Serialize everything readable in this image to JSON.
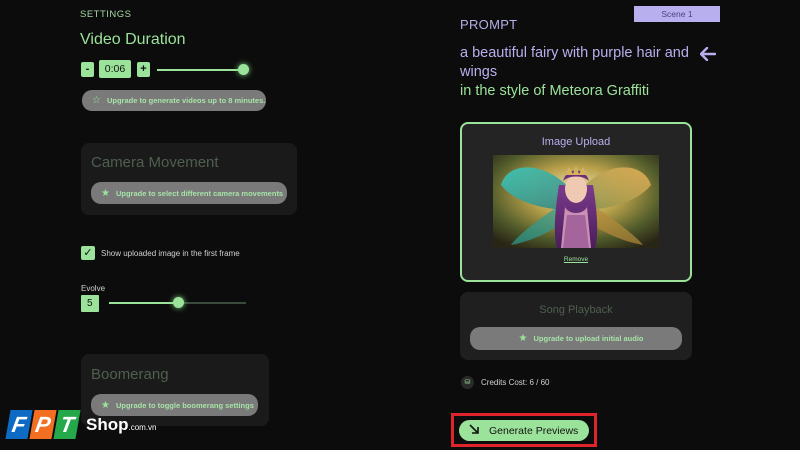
{
  "settings": {
    "label": "SETTINGS",
    "video_duration": {
      "title": "Video Duration",
      "minus": "-",
      "plus": "+",
      "value": "0:06",
      "slider_fraction": 1.0,
      "upgrade_text": "Upgrade to generate videos up to 8 minutes."
    },
    "camera_movement": {
      "title": "Camera Movement",
      "upgrade_text": "Upgrade to select different camera movements"
    },
    "show_uploaded": {
      "checked": true,
      "label": "Show uploaded image in the first frame"
    },
    "evolve": {
      "label": "Evolve",
      "value": "5",
      "slider_fraction": 0.5
    },
    "boomerang": {
      "title": "Boomerang",
      "upgrade_text": "Upgrade to toggle boomerang settings"
    }
  },
  "scene": {
    "tag": "Scene 1"
  },
  "prompt": {
    "label": "PROMPT",
    "text": "a beautiful fairy with purple hair and wings",
    "style": "in the style of Meteora Graffiti",
    "back_icon": "arrow-left-icon"
  },
  "image_upload": {
    "title": "Image Upload",
    "remove": "Remove"
  },
  "song_playback": {
    "title": "Song Playback",
    "upgrade_text": "Upgrade to upload initial audio"
  },
  "credits": {
    "text": "Credits Cost: 6 / 60"
  },
  "generate": {
    "label": "Generate Previews"
  },
  "logo": {
    "brand": "FPT",
    "f": "F",
    "p": "P",
    "t": "T",
    "shop": "Shop",
    "domain": ".com.vn"
  },
  "colors": {
    "accent_green": "#9be39b",
    "accent_purple": "#b8b0ee",
    "background": "#0c0c0c",
    "highlight_red": "#e0242c"
  }
}
